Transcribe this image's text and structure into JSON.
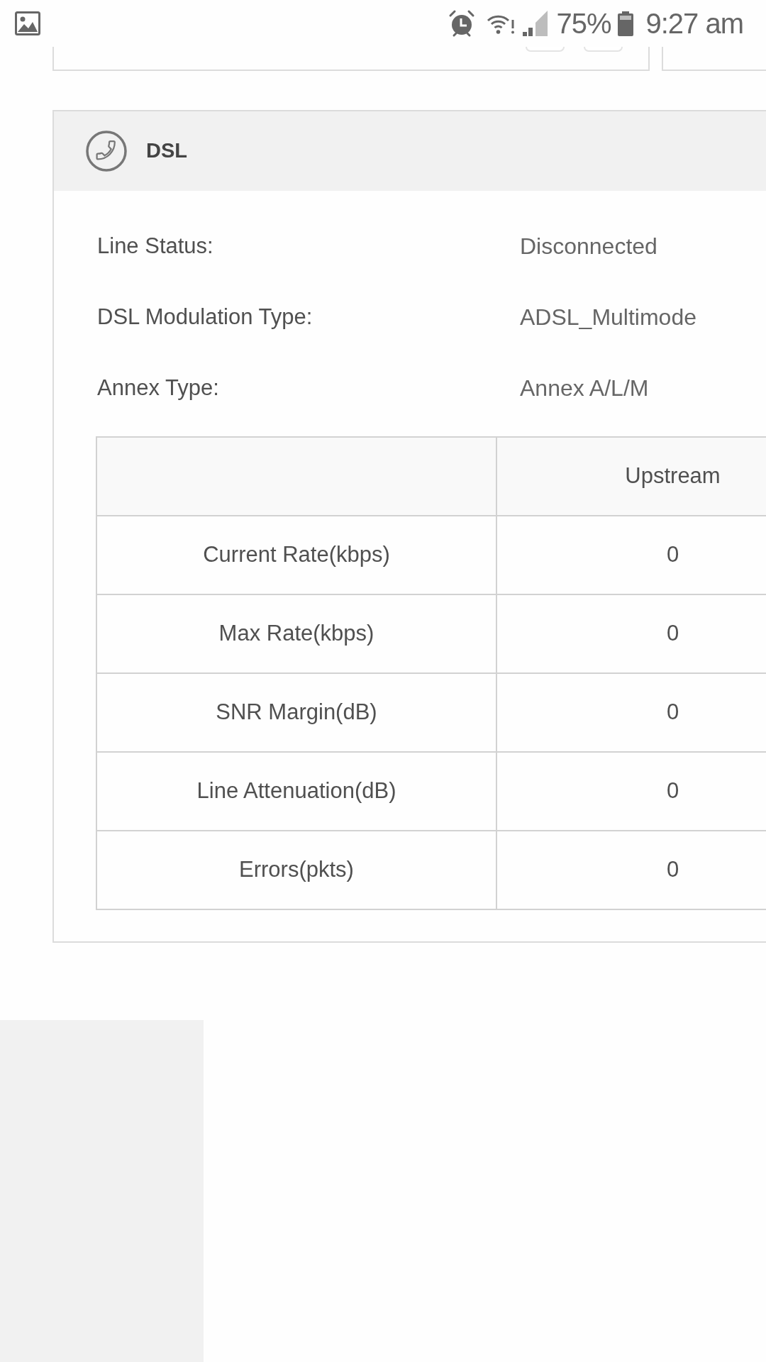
{
  "status_bar": {
    "battery": "75%",
    "time": "9:27 am"
  },
  "dsl_panel": {
    "title": "DSL",
    "fields": [
      {
        "label": "Line Status:",
        "value": "Disconnected"
      },
      {
        "label": "DSL Modulation Type:",
        "value": "ADSL_Multimode"
      },
      {
        "label": "Annex Type:",
        "value": "Annex A/L/M"
      }
    ],
    "table": {
      "columns": [
        "Upstream"
      ],
      "rows": [
        {
          "label": "Current Rate(kbps)",
          "values": [
            "0"
          ]
        },
        {
          "label": "Max Rate(kbps)",
          "values": [
            "0"
          ]
        },
        {
          "label": "SNR Margin(dB)",
          "values": [
            "0"
          ]
        },
        {
          "label": "Line Attenuation(dB)",
          "values": [
            "0"
          ]
        },
        {
          "label": "Errors(pkts)",
          "values": [
            "0"
          ]
        }
      ]
    }
  }
}
